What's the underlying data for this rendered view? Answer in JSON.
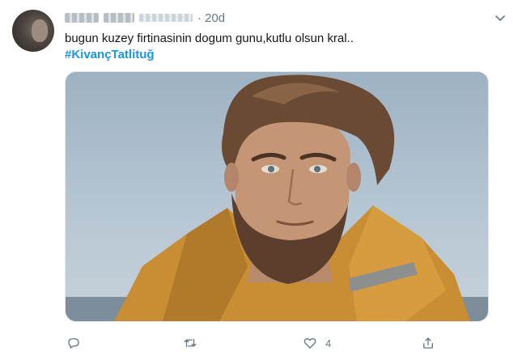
{
  "tweet": {
    "time": "20d",
    "separator": "·",
    "text": "bugun kuzey firtinasinin dogum gunu,kutlu olsun kral..",
    "hashtag": "#KivançTatlituğ",
    "like_count": "4"
  },
  "icons": {
    "caret": "chevron-down-icon",
    "reply": "reply-icon",
    "retweet": "retweet-icon",
    "like": "heart-icon",
    "share": "share-icon"
  },
  "colors": {
    "link": "#1b95e0",
    "muted": "#657786",
    "text": "#14171a"
  }
}
